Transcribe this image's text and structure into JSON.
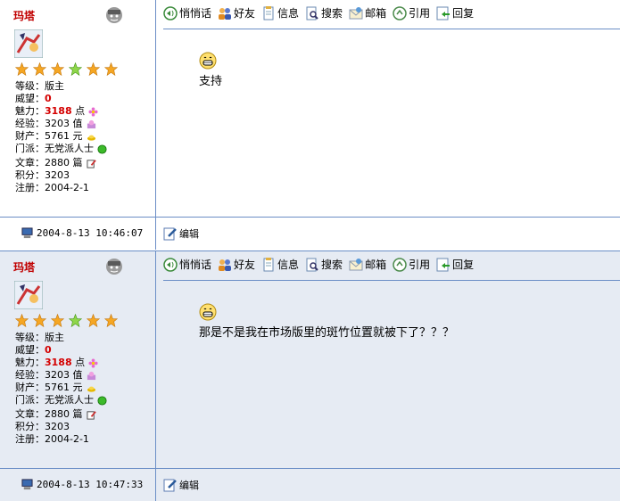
{
  "toolbar": {
    "whisper": "悄悄话",
    "friend": "好友",
    "info": "信息",
    "search": "搜索",
    "mail": "邮箱",
    "quote": "引用",
    "reply": "回复"
  },
  "footer_edit": "编辑",
  "colors": {
    "username": "#c00000",
    "accent_red": "#d40000",
    "border": "#6b8ec6",
    "alt_bg": "#e6ebf3"
  },
  "posts": [
    {
      "username": "玛塔",
      "rank": "等级：版主",
      "prestige_label": "威望：",
      "prestige": "0",
      "charm_label": "魅力：",
      "charm": "3188",
      "charm_unit": "点",
      "exp": "经验：3203 值",
      "wealth": "财产：5761 元",
      "faction": "门派：无党派人士",
      "articles": "文章：2880 篇",
      "points": "积分：3203",
      "registered": "注册：2004-2-1",
      "timestamp": "2004-8-13 10:46:07",
      "message": "支持"
    },
    {
      "username": "玛塔",
      "rank": "等级：版主",
      "prestige_label": "威望：",
      "prestige": "0",
      "charm_label": "魅力：",
      "charm": "3188",
      "charm_unit": "点",
      "exp": "经验：3203 值",
      "wealth": "财产：5761 元",
      "faction": "门派：无党派人士",
      "articles": "文章：2880 篇",
      "points": "积分：3203",
      "registered": "注册：2004-2-1",
      "timestamp": "2004-8-13 10:47:33",
      "message": "那是不是我在市场版里的斑竹位置就被下了？？？"
    }
  ]
}
